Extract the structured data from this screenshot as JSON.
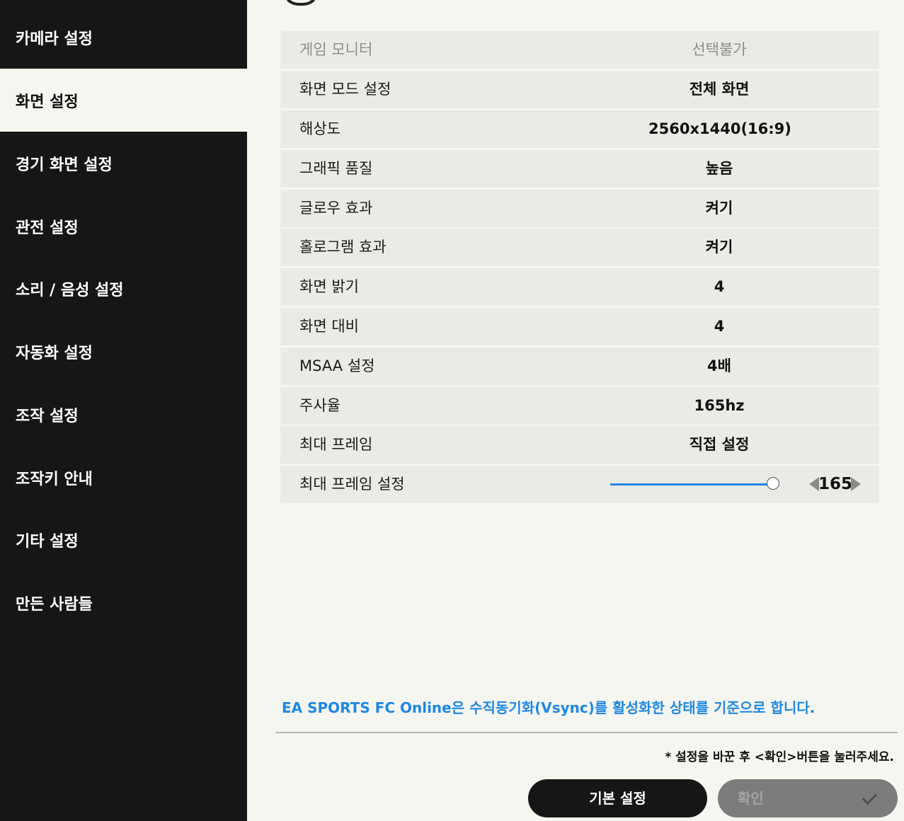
{
  "sidebar": {
    "items": [
      {
        "label": "카메라 설정"
      },
      {
        "label": "화면 설정",
        "active": true
      },
      {
        "label": "경기 화면 설정"
      },
      {
        "label": "관전 설정"
      },
      {
        "label": "소리 / 음성 설정"
      },
      {
        "label": "자동화 설정"
      },
      {
        "label": "조작 설정"
      },
      {
        "label": "조작키 안내"
      },
      {
        "label": "기타 설정"
      },
      {
        "label": "만든 사람들"
      }
    ]
  },
  "settings": {
    "rows": [
      {
        "label": "게임 모니터",
        "value": "선택불가"
      },
      {
        "label": "화면 모드 설정",
        "value": "전체 화면"
      },
      {
        "label": "해상도",
        "value": "2560x1440(16:9)"
      },
      {
        "label": "그래픽 품질",
        "value": "높음"
      },
      {
        "label": "글로우 효과",
        "value": "켜기"
      },
      {
        "label": "홀로그램 효과",
        "value": "켜기"
      },
      {
        "label": "화면 밝기",
        "value": "4"
      },
      {
        "label": "화면 대비",
        "value": "4"
      },
      {
        "label": "MSAA 설정",
        "value": "4배"
      },
      {
        "label": "주사율",
        "value": "165hz"
      },
      {
        "label": "최대 프레임",
        "value": "직접 설정"
      }
    ],
    "max_frame_setting": {
      "label": "최대 프레임 설정",
      "value": "165",
      "slider_fraction": 1.0
    }
  },
  "notes": {
    "vsync": "EA SPORTS FC Online은 수직동기화(Vsync)를 활성화한 상태를 기준으로 합니다.",
    "confirm_hint": "* 설정을 바꾼 후 <확인>버튼을 눌러주세요."
  },
  "buttons": {
    "default_label": "기본 설정",
    "confirm_label": "확인",
    "confirm_icon": "check-icon"
  },
  "colors": {
    "accent": "#1e88e5",
    "sidebar_bg": "#161616",
    "page_bg": "#f6f6f1",
    "row_bg": "#ebebe6"
  }
}
